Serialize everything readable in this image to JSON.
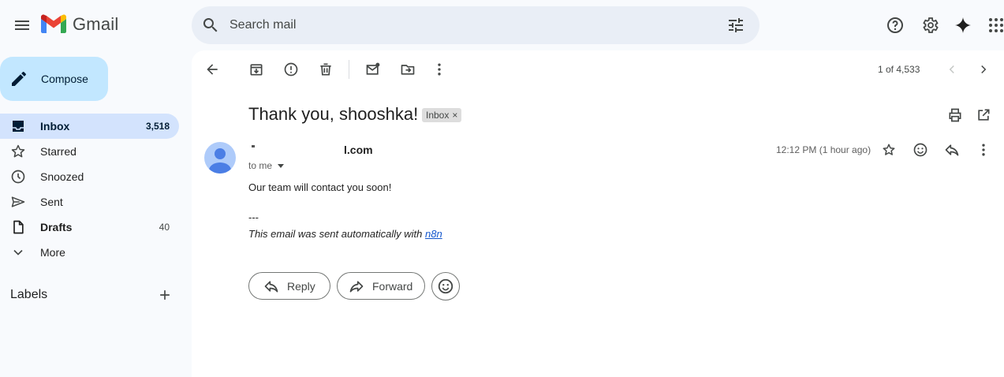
{
  "app": {
    "name": "Gmail",
    "logo_colors": {
      "red": "#ea4335",
      "blue": "#4285f4",
      "green": "#34a853",
      "yellow": "#fbbc04",
      "dark_red": "#c5221f"
    }
  },
  "header": {
    "search_placeholder": "Search mail",
    "icons": [
      "menu-icon",
      "search-icon",
      "filter-icon",
      "help-icon",
      "settings-icon",
      "gemini-icon",
      "apps-icon"
    ]
  },
  "sidebar": {
    "compose_label": "Compose",
    "items": [
      {
        "label": "Inbox",
        "count": "3,518",
        "icon": "inbox-icon",
        "active": true
      },
      {
        "label": "Starred",
        "count": "",
        "icon": "star-icon"
      },
      {
        "label": "Snoozed",
        "count": "",
        "icon": "clock-icon"
      },
      {
        "label": "Sent",
        "count": "",
        "icon": "send-icon"
      },
      {
        "label": "Drafts",
        "count": "40",
        "icon": "draft-icon"
      },
      {
        "label": "More",
        "count": "",
        "icon": "chevron-down-icon"
      }
    ],
    "labels_title": "Labels"
  },
  "toolbar": {
    "icons": [
      "back-icon",
      "archive-icon",
      "report-spam-icon",
      "delete-icon",
      "mark-unread-icon",
      "move-to-icon",
      "more-vert-icon"
    ],
    "pager_text": "1 of 4,533"
  },
  "message": {
    "subject": "Thank you, shooshka!",
    "label_chip": "Inbox",
    "label_chip_close": "×",
    "sender_visible": "l.com",
    "to_text": "to me",
    "timestamp": "12:12 PM (1 hour ago)",
    "body": "Our team will contact you soon!",
    "signature_dash": "---",
    "signature_prefix": "This email was sent automatically with ",
    "signature_link": "n8n"
  },
  "actions": {
    "reply_label": "Reply",
    "forward_label": "Forward"
  },
  "colors": {
    "background": "#f8fafd",
    "compose_bg": "#c2e7ff",
    "active_nav_bg": "#d3e3fd",
    "search_bg": "#e9eef6",
    "link": "#1155cc"
  }
}
